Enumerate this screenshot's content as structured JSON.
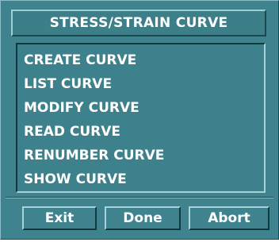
{
  "window": {
    "title": "STRESS/STRAIN CURVE"
  },
  "menu": {
    "items": [
      {
        "label": "CREATE CURVE"
      },
      {
        "label": "LIST CURVE"
      },
      {
        "label": "MODIFY CURVE"
      },
      {
        "label": "READ CURVE"
      },
      {
        "label": "RENUMBER CURVE"
      },
      {
        "label": "SHOW CURVE"
      }
    ]
  },
  "buttons": {
    "exit_label": "Exit",
    "done_label": "Done",
    "abort_label": "Abort"
  },
  "colors": {
    "panel": "#3f838e",
    "text": "#ffffff",
    "highlight": "#9ccfd6",
    "shadow": "#12393e"
  }
}
